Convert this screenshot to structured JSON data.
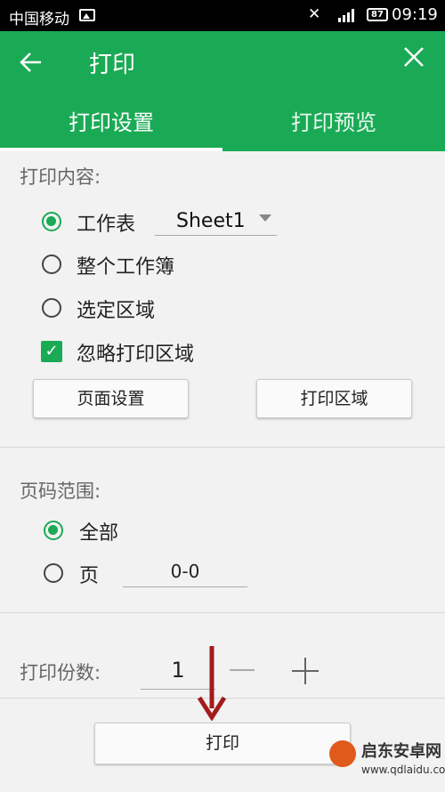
{
  "status_bar": {
    "carrier": "中国移动",
    "battery": "87",
    "time": "09:19"
  },
  "header": {
    "title": "打印"
  },
  "tabs": [
    {
      "label": "打印设置"
    },
    {
      "label": "打印预览"
    }
  ],
  "print_content": {
    "label": "打印内容:",
    "worksheet_label": "工作表",
    "worksheet_value": "Sheet1",
    "whole_workbook_label": "整个工作簿",
    "selection_label": "选定区域",
    "ignore_area_label": "忽略打印区域",
    "page_setup_button": "页面设置",
    "print_area_button": "打印区域"
  },
  "page_range": {
    "label": "页码范围:",
    "all_label": "全部",
    "pages_label": "页",
    "pages_value": "0-0"
  },
  "copies": {
    "label": "打印份数:",
    "value": "1"
  },
  "print_button": "打印",
  "watermark": {
    "name": "启东安卓网",
    "url": "www.qdlaidu.com"
  },
  "colors": {
    "accent": "#1aaa55",
    "arrow": "#a31b1b"
  }
}
